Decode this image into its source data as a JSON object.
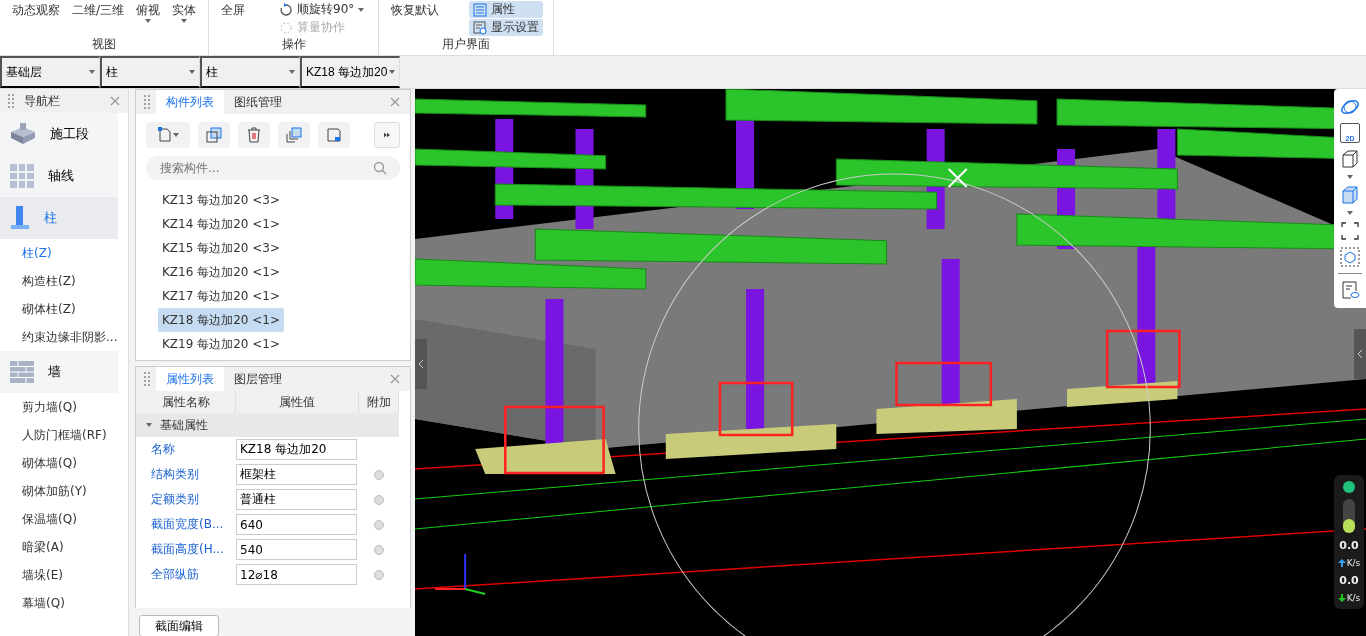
{
  "ribbon": {
    "groups": [
      {
        "label": "视图",
        "items": [
          {
            "label": "动态观察",
            "kind": "plain"
          },
          {
            "label": "二维/三维",
            "kind": "plain"
          },
          {
            "label": "俯视",
            "kind": "menu"
          },
          {
            "label": "实体",
            "kind": "menu"
          }
        ]
      },
      {
        "label": "操作",
        "items": [
          {
            "label": "全屏",
            "kind": "plain"
          },
          {
            "label": "顺旋转90°",
            "kind": "rotate",
            "disabled": false
          },
          {
            "label": "算量协作",
            "kind": "collab",
            "disabled": true
          }
        ]
      },
      {
        "label": "用户界面",
        "items": [
          {
            "label": "恢复默认",
            "kind": "plain"
          },
          {
            "label": "属性",
            "kind": "toggle-list",
            "selected": true
          },
          {
            "label": "显示设置",
            "kind": "toggle-display",
            "selected": true
          }
        ]
      }
    ]
  },
  "filter_bar": [
    {
      "value": "基础层"
    },
    {
      "value": "柱"
    },
    {
      "value": "柱"
    },
    {
      "value": "KZ18 每边加20"
    }
  ],
  "nav_panel": {
    "title": "导航栏",
    "items": [
      {
        "label": "施工段",
        "kind": "category",
        "selected": false
      },
      {
        "label": "轴线",
        "kind": "category",
        "selected": false
      },
      {
        "label": "柱",
        "kind": "category",
        "selected": true
      },
      {
        "label": "柱(Z)",
        "kind": "sub",
        "selected": true
      },
      {
        "label": "构造柱(Z)",
        "kind": "sub",
        "selected": false
      },
      {
        "label": "砌体柱(Z)",
        "kind": "sub",
        "selected": false
      },
      {
        "label": "约束边缘非阴影...",
        "kind": "sub",
        "selected": false
      },
      {
        "label": "墙",
        "kind": "category",
        "selected": false
      },
      {
        "label": "剪力墙(Q)",
        "kind": "sub",
        "selected": false
      },
      {
        "label": "人防门框墙(RF)",
        "kind": "sub",
        "selected": false
      },
      {
        "label": "砌体墙(Q)",
        "kind": "sub",
        "selected": false
      },
      {
        "label": "砌体加筋(Y)",
        "kind": "sub",
        "selected": false
      },
      {
        "label": "保温墙(Q)",
        "kind": "sub",
        "selected": false
      },
      {
        "label": "暗梁(A)",
        "kind": "sub",
        "selected": false
      },
      {
        "label": "墙垛(E)",
        "kind": "sub",
        "selected": false
      },
      {
        "label": "幕墙(Q)",
        "kind": "sub",
        "selected": false
      }
    ]
  },
  "component_panel": {
    "tabs": [
      {
        "label": "构件列表",
        "selected": true
      },
      {
        "label": "图纸管理",
        "selected": false
      }
    ],
    "search": {
      "placeholder": "搜索构件..."
    },
    "components": [
      {
        "label": "KZ13 每边加20 <3>",
        "selected": false
      },
      {
        "label": "KZ14 每边加20 <1>",
        "selected": false
      },
      {
        "label": "KZ15 每边加20 <3>",
        "selected": false
      },
      {
        "label": "KZ16 每边加20 <1>",
        "selected": false
      },
      {
        "label": "KZ17 每边加20 <1>",
        "selected": false
      },
      {
        "label": "KZ18 每边加20 <1>",
        "selected": true
      },
      {
        "label": "KZ19 每边加20 <1>",
        "selected": false
      }
    ]
  },
  "property_panel": {
    "tabs": [
      {
        "label": "属性列表",
        "selected": true
      },
      {
        "label": "图层管理",
        "selected": false
      }
    ],
    "columns": [
      "属性名称",
      "属性值",
      "附加"
    ],
    "section": {
      "label": "基础属性",
      "expanded": true
    },
    "rows": [
      {
        "name": "名称",
        "value": "KZ18 每边加20",
        "has_option": false
      },
      {
        "name": "结构类别",
        "value": "框架柱",
        "has_option": true
      },
      {
        "name": "定额类别",
        "value": "普通柱",
        "has_option": true
      },
      {
        "name": "截面宽度(B...",
        "value": "640",
        "has_option": true
      },
      {
        "name": "截面高度(H...",
        "value": "540",
        "has_option": true
      },
      {
        "name": "全部纵筋",
        "value": "12⌀18",
        "has_option": true
      }
    ],
    "edit_button": "截面编辑"
  },
  "view_toolbar": {
    "label_2d": "2D"
  },
  "network": [
    {
      "value": "0.0",
      "unit": "K/s"
    },
    {
      "value": "0.0",
      "unit": "K/s"
    }
  ]
}
